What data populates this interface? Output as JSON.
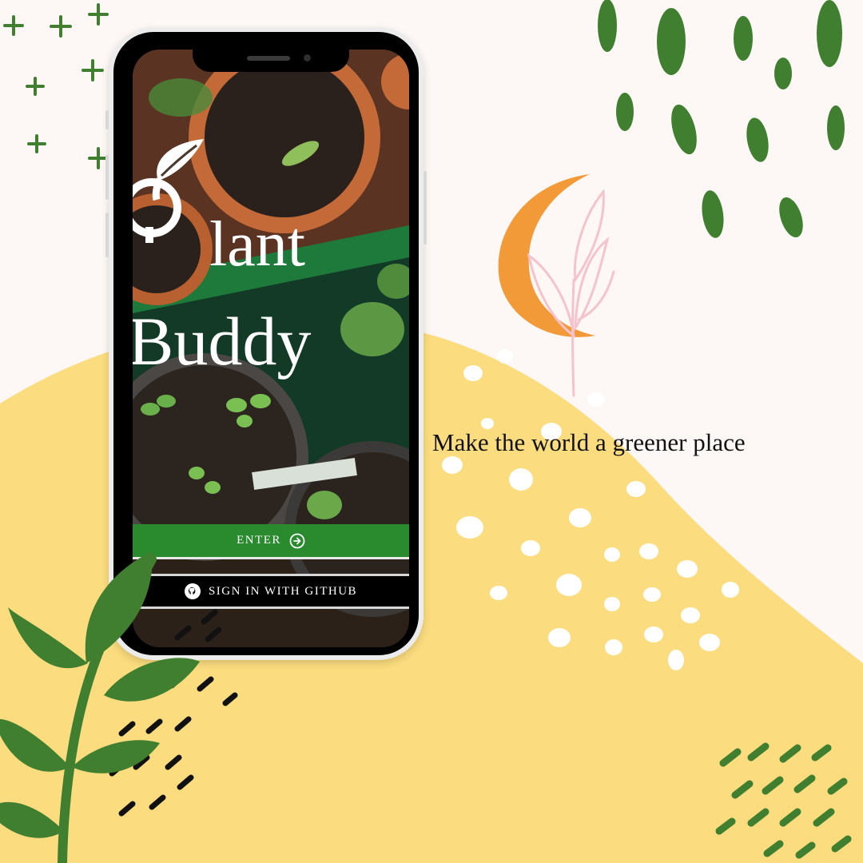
{
  "app": {
    "title_line1": "lant",
    "title_line2": "Buddy"
  },
  "buttons": {
    "enter_label": "ENTER",
    "github_label": "SIGN IN WITH GITHUB"
  },
  "tagline": "Make the world a greener place",
  "icons": {
    "logo": "leaf-sprout-logo-icon",
    "enter": "arrow-circle-right-icon",
    "github": "github-icon"
  },
  "colors": {
    "background": "#fdf8f5",
    "yellow": "#fbdc7e",
    "green": "#3f7f2f",
    "enter_button": "#2a8a2e",
    "orange": "#f39a38",
    "pink": "#f5c3cc"
  }
}
